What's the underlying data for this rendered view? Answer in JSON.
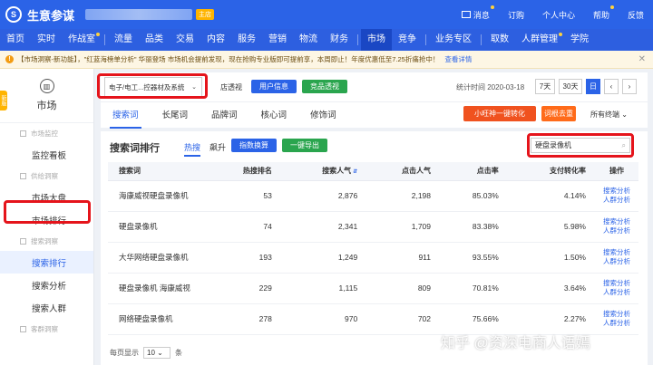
{
  "header": {
    "brand": "生意参谋",
    "logo_glyph": "S",
    "shop_badge": "主店",
    "right_items": [
      "消息",
      "订购",
      "个人中心",
      "帮助",
      "反馈"
    ]
  },
  "nav": {
    "items": [
      "首页",
      "实时",
      "作战室",
      "流量",
      "品类",
      "交易",
      "内容",
      "服务",
      "营销",
      "物流",
      "财务",
      "市场",
      "竞争",
      "业务专区",
      "取数",
      "人群管理",
      "学院"
    ],
    "active": "市场"
  },
  "notice": {
    "text": "【市场洞察-新功能】，\"红蓝海榜单分析\" 华丽登场 市场机会提前发现，现在抢购专业版即可提前享，本周即止！年度优惠低至7.25折痛抢中！",
    "link": "查看详情"
  },
  "sidebar": {
    "title": "市场",
    "tab_label": "新版",
    "groups": [
      {
        "label": "市场监控",
        "items": [
          "监控看板"
        ]
      },
      {
        "label": "供给洞察",
        "items": [
          "市场大盘",
          "市场排行"
        ]
      },
      {
        "label": "搜索洞察",
        "items": [
          "搜索排行",
          "搜索分析",
          "搜索人群"
        ]
      },
      {
        "label": "客群洞察",
        "items": []
      }
    ],
    "active": "搜索排行"
  },
  "toolbar": {
    "category": "电子/电工...控器材及系统",
    "store_label": "店透视",
    "user_info_btn": "用户信息",
    "competitor_btn": "竞品透视",
    "stat_time": "统计时间 2020-03-18",
    "range_7": "7天",
    "range_30": "30天",
    "range_day": "日",
    "prev": "‹",
    "next": "›"
  },
  "subtabs": [
    "搜索词",
    "长尾词",
    "品牌词",
    "核心词",
    "修饰词"
  ],
  "subtab_active": "搜索词",
  "actions": {
    "convert": "小旺神一键转化",
    "word_remove": "词根去重",
    "terminal": "所有终端"
  },
  "ranking": {
    "title": "搜索词排行",
    "tab_hot": "热搜",
    "tab_rise": "飙升",
    "index_btn": "指数换算",
    "export_btn": "一键导出",
    "search_value": "硬盘录像机",
    "columns": [
      "搜索词",
      "热搜排名",
      "搜索人气",
      "点击人气",
      "点击率",
      "支付转化率",
      "操作"
    ],
    "rows": [
      [
        "海康威视硬盘录像机",
        "53",
        "2,876",
        "2,198",
        "85.03%",
        "4.14%"
      ],
      [
        "硬盘录像机",
        "74",
        "2,341",
        "1,709",
        "83.38%",
        "5.98%"
      ],
      [
        "大华网络硬盘录像机",
        "193",
        "1,249",
        "911",
        "93.55%",
        "1.50%"
      ],
      [
        "硬盘录像机 海康威视",
        "229",
        "1,115",
        "809",
        "70.81%",
        "3.64%"
      ],
      [
        "网络硬盘录像机",
        "278",
        "970",
        "702",
        "75.66%",
        "2.27%"
      ]
    ],
    "op_search": "搜索分析",
    "op_crowd": "人群分析",
    "page_label": "每页显示",
    "page_size": "10",
    "page_unit": "条"
  },
  "watermark": "知乎 @资深电商人语嫣"
}
